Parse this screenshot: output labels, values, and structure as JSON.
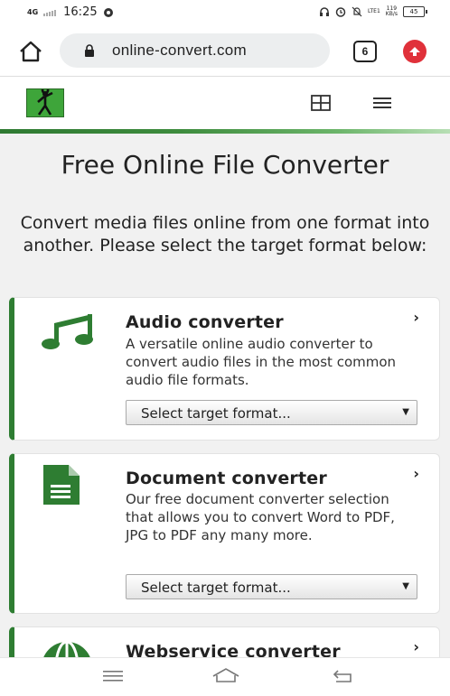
{
  "status_bar": {
    "network": "4G",
    "time": "16:25",
    "speed": "119",
    "speed_unit": "KB/s",
    "lte": "LTE1",
    "battery": "45"
  },
  "browser": {
    "url": "online-convert.com",
    "tab_count": "6"
  },
  "hero": {
    "title": "Free Online File Converter",
    "subtitle": "Convert media files online from one format into another. Please select the target format below:"
  },
  "cards": [
    {
      "title": "Audio converter",
      "description": "A versatile online audio converter to convert audio files in the most common audio file formats.",
      "select_placeholder": "Select target format...",
      "icon": "music-note-icon"
    },
    {
      "title": "Document converter",
      "description": "Our free document converter selection that allows you to convert Word to PDF, JPG to PDF any many more.",
      "select_placeholder": "Select target format...",
      "icon": "document-icon"
    },
    {
      "title": "Webservice converter",
      "icon": "globe-icon"
    }
  ],
  "colors": {
    "accent_green": "#2e7d32",
    "brand_red": "#e0313a"
  }
}
